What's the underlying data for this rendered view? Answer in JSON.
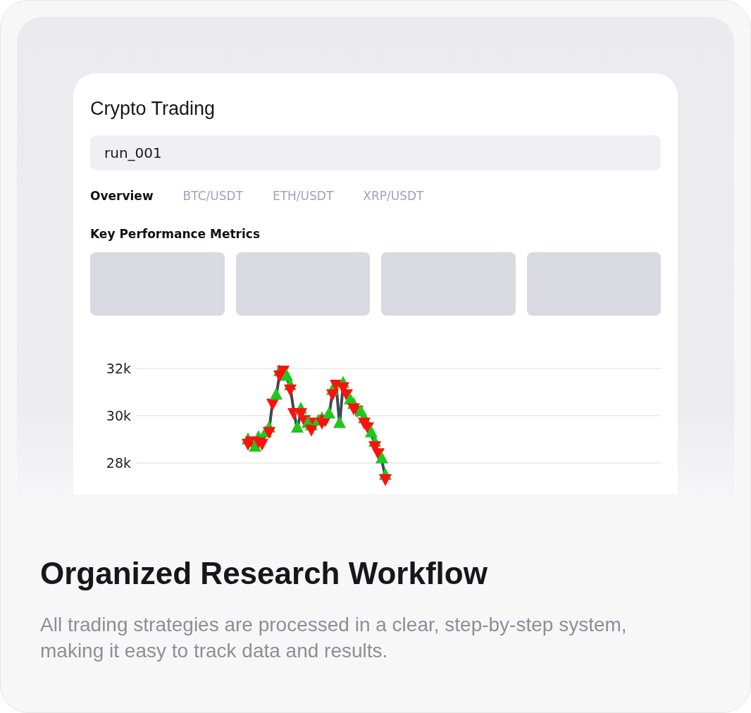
{
  "preview": {
    "title": "Crypto Trading",
    "run_field": {
      "value": "run_001"
    },
    "tabs": [
      {
        "label": "Overview",
        "selected": true
      },
      {
        "label": "BTC/USDT",
        "selected": false
      },
      {
        "label": "ETH/USDT",
        "selected": false
      },
      {
        "label": "XRP/USDT",
        "selected": false
      }
    ],
    "metrics_heading": "Key Performance Metrics",
    "chart": {
      "y_axis_labels": [
        "32k",
        "30k",
        "28k"
      ]
    }
  },
  "headline": "Organized Research Workflow",
  "description": "All trading strategies are processed in a clear, step-by-step system, making it easy to track data and results."
}
